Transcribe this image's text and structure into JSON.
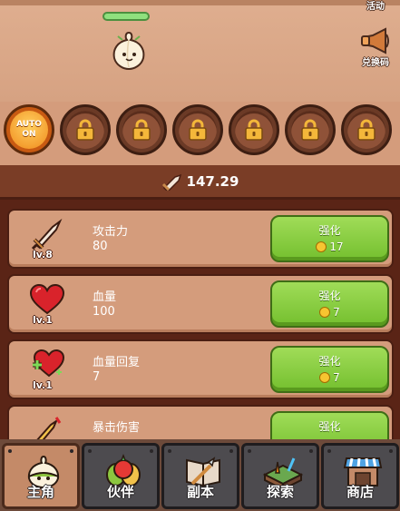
{
  "corner": {
    "event_label": "活动",
    "redeem_label": "兑换码"
  },
  "slots": {
    "auto_top": "AUTO",
    "auto_bottom": "ON",
    "locked_count": 6
  },
  "power": {
    "value": "147.29"
  },
  "upgrades": [
    {
      "name": "攻击力",
      "value": "80",
      "level": "lv.8",
      "button": "强化",
      "cost": "17"
    },
    {
      "name": "血量",
      "value": "100",
      "level": "lv.1",
      "button": "强化",
      "cost": "7"
    },
    {
      "name": "血量回复",
      "value": "7",
      "level": "lv.1",
      "button": "强化",
      "cost": "7"
    },
    {
      "name": "暴击伤害",
      "value": "",
      "level": "",
      "button": "强化",
      "cost": ""
    }
  ],
  "nav": {
    "items": [
      {
        "label": "主角",
        "icon": "garlic-hero-icon",
        "active": true
      },
      {
        "label": "伙伴",
        "icon": "veggie-partner-icon",
        "active": false
      },
      {
        "label": "副本",
        "icon": "dungeon-book-icon",
        "active": false
      },
      {
        "label": "探索",
        "icon": "farm-explore-icon",
        "active": false
      },
      {
        "label": "商店",
        "icon": "shop-stall-icon",
        "active": false
      }
    ]
  },
  "colors": {
    "upgrade_button": "#86cc3c",
    "panel": "#d49c7c",
    "dark_bg": "#5a2416"
  }
}
